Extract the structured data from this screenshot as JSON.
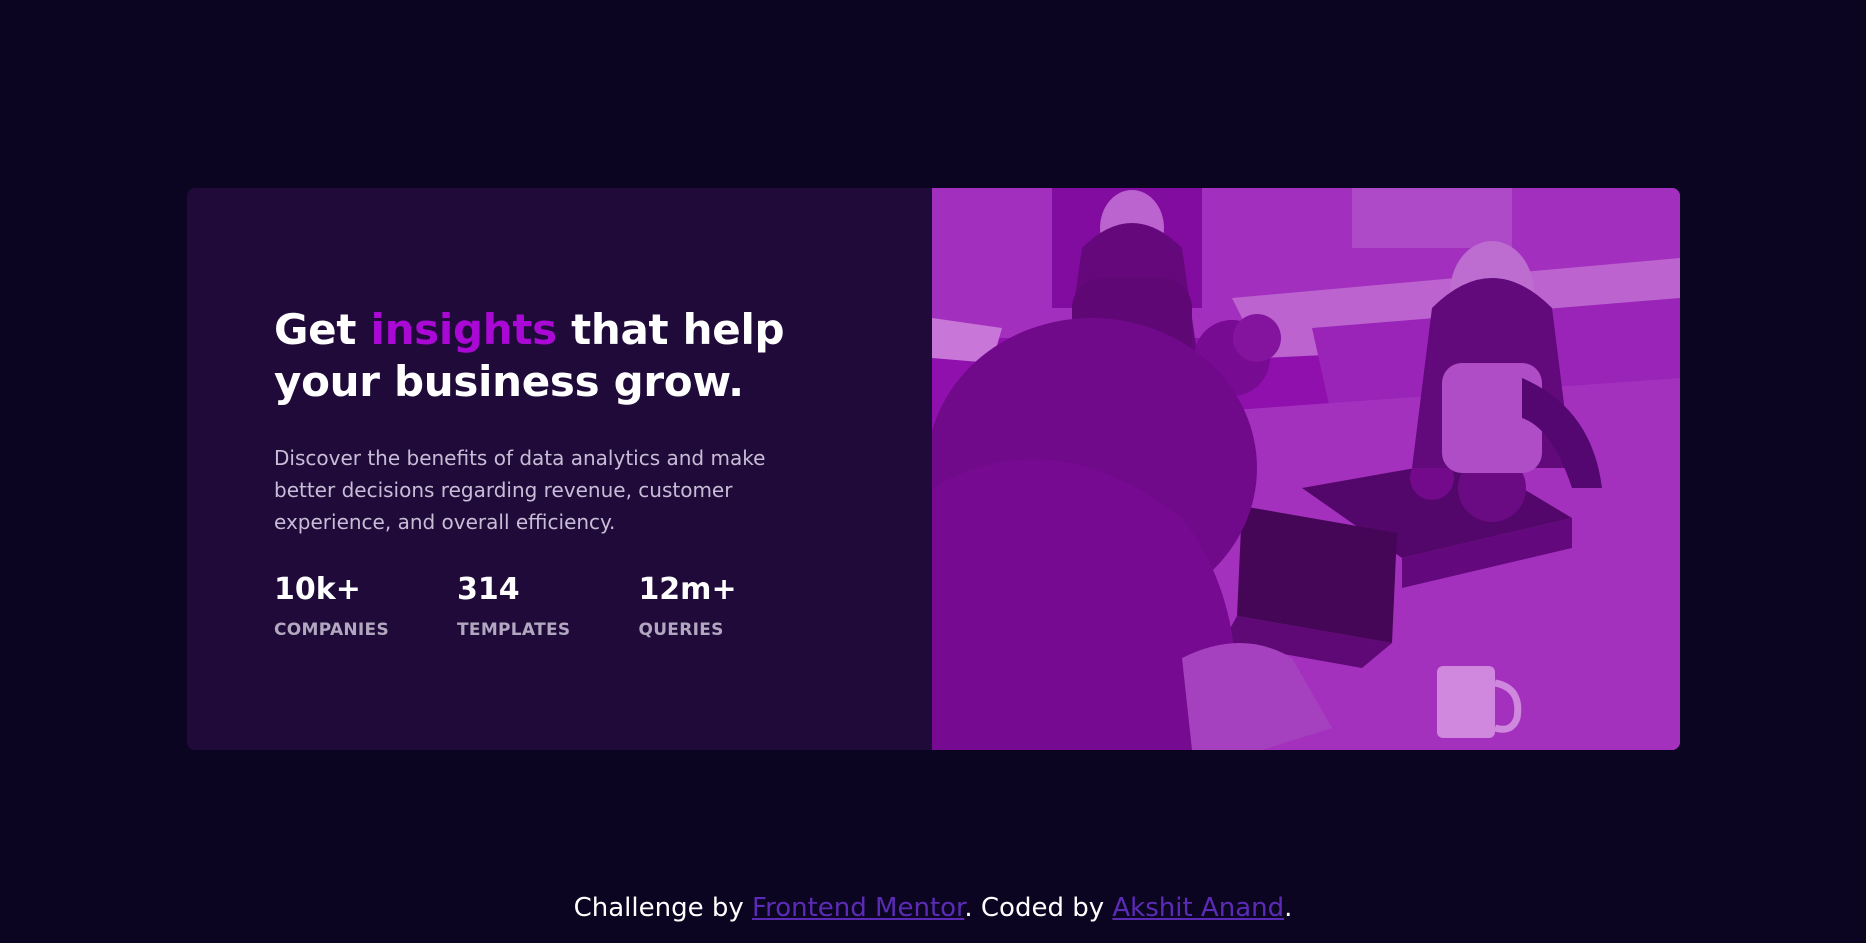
{
  "headline": {
    "before": "Get ",
    "accent": "insights",
    "after": " that help your business grow."
  },
  "description": "Discover the benefits of data analytics and make better decisions regarding revenue, customer experience, and overall efficiency.",
  "stats": [
    {
      "value": "10k+",
      "label": "COMPANIES"
    },
    {
      "value": "314",
      "label": "TEMPLATES"
    },
    {
      "value": "12m+",
      "label": "QUERIES"
    }
  ],
  "footer": {
    "prefix": "Challenge by ",
    "link1": "Frontend Mentor",
    "middle": ". Coded by ",
    "link2": "Akshit Anand",
    "suffix": "."
  },
  "colors": {
    "background": "#0b0521",
    "card": "#1f0a39",
    "accent": "#aa08d5",
    "image_tint": "#8a0ea8",
    "link": "#5c2bb6"
  }
}
